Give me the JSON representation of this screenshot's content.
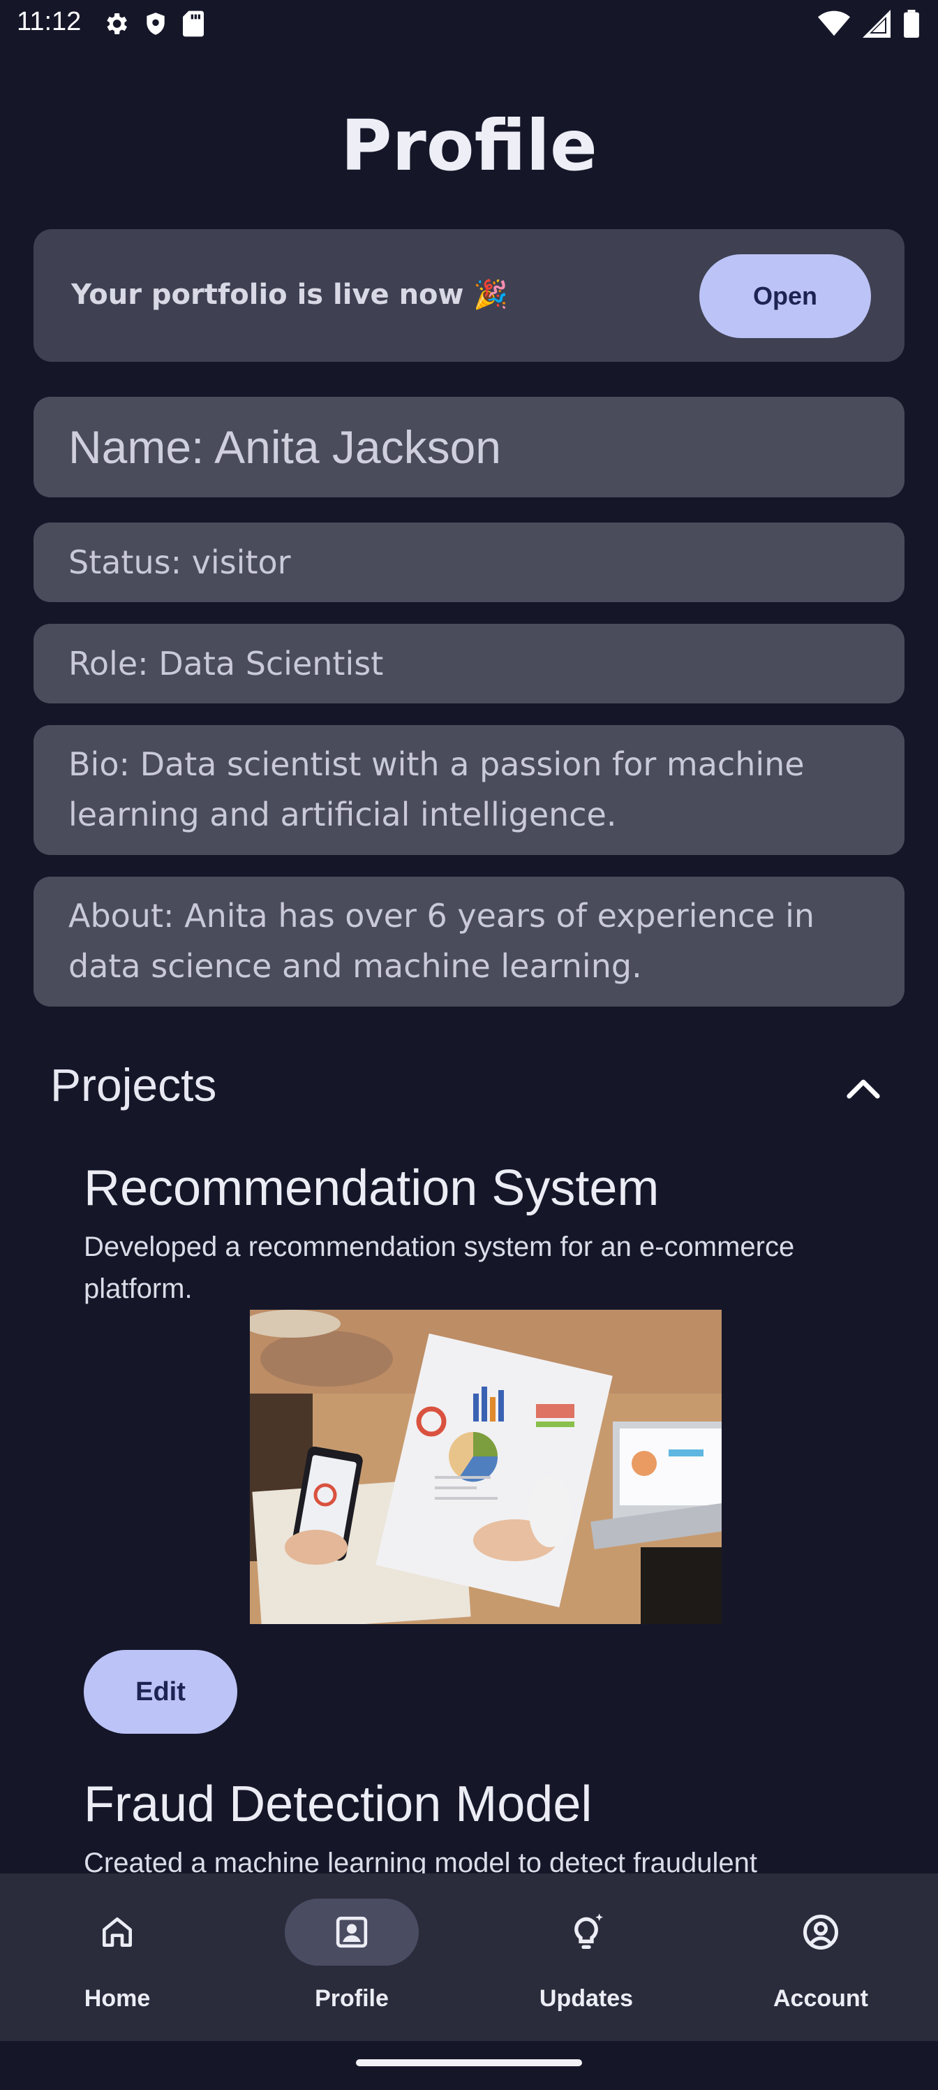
{
  "status_bar": {
    "time": "11:12",
    "left_icons": [
      "gear-icon",
      "shield-icon",
      "sd-card-icon"
    ],
    "right_icons": [
      "wifi-icon",
      "signal-icon",
      "battery-icon"
    ]
  },
  "page": {
    "title": "Profile"
  },
  "banner": {
    "text": "Your portfolio is live now 🎉",
    "button_label": "Open"
  },
  "profile": {
    "name": "Name: Anita Jackson",
    "status": "Status: visitor",
    "role": "Role: Data Scientist",
    "bio": "Bio: Data scientist with a passion for machine learning and artificial intelligence.",
    "about": "About: Anita has over 6 years of experience in data science and machine learning."
  },
  "projects": {
    "header": "Projects",
    "items": [
      {
        "title": "Recommendation System",
        "description": "Developed a recommendation system for an e-commerce platform.",
        "edit_label": "Edit"
      },
      {
        "title": "Fraud Detection Model",
        "description": "Created a machine learning model to detect fraudulent"
      }
    ]
  },
  "nav": {
    "items": [
      {
        "label": "Home",
        "icon": "home-icon"
      },
      {
        "label": "Profile",
        "icon": "profile-icon",
        "active": true
      },
      {
        "label": "Updates",
        "icon": "lightbulb-icon"
      },
      {
        "label": "Account",
        "icon": "account-icon"
      }
    ]
  },
  "colors": {
    "background": "#151729",
    "card": "#4a4b5b",
    "accent_button": "#bcc3f6",
    "nav_bar": "#2a2c3c"
  }
}
